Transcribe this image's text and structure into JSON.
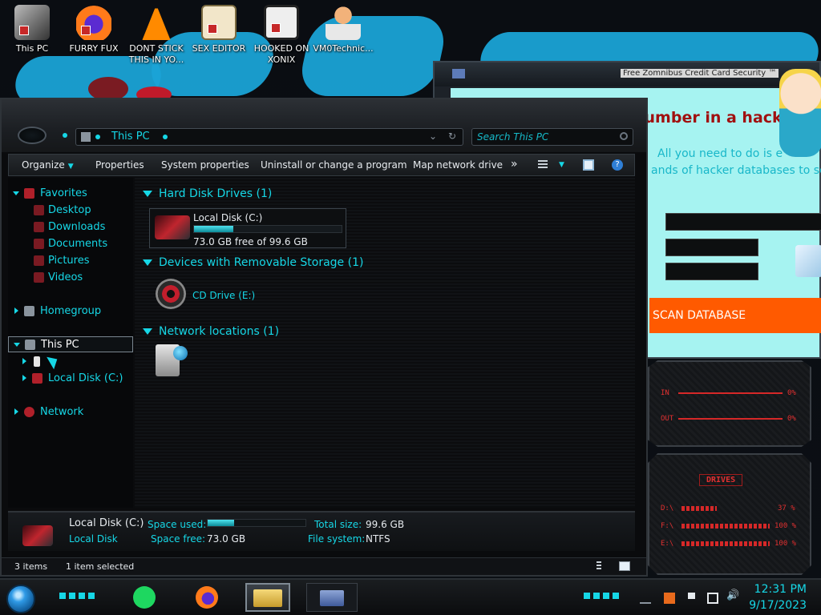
{
  "desktop": {
    "icons": [
      {
        "label": "This PC"
      },
      {
        "label": "FURRY FUX"
      },
      {
        "label": "DONT STICK THIS IN YO..."
      },
      {
        "label": "SEX EDITOR"
      },
      {
        "label": "HOOKED ON XONIX"
      },
      {
        "label": "VM0Technic..."
      }
    ]
  },
  "background_window": {
    "title": "Free Zomnibus Credit Card Security ™",
    "heading": "number in a hack",
    "line1": "All you need to do is e",
    "line2": "ands of hacker databases to see",
    "scan_button": "SCAN DATABASE"
  },
  "widgets": {
    "network_in_label": "IN",
    "network_out_label": "OUT",
    "network_in_value": "0%",
    "network_out_value": "0%",
    "drives_title": "DRIVES",
    "drives": [
      {
        "letter": "D:\\",
        "value": "37 %"
      },
      {
        "letter": "F:\\",
        "value": "100 %"
      },
      {
        "letter": "E:\\",
        "value": "100 %"
      }
    ]
  },
  "explorer": {
    "address": "This PC",
    "search_placeholder": "Search This PC",
    "toolbar": {
      "organize": "Organize",
      "properties": "Properties",
      "system_properties": "System properties",
      "uninstall": "Uninstall or change a program",
      "map_drive": "Map network drive",
      "more": "»"
    },
    "nav": {
      "favorites": "Favorites",
      "desktop": "Desktop",
      "downloads": "Downloads",
      "documents": "Documents",
      "pictures": "Pictures",
      "videos": "Videos",
      "homegroup": "Homegroup",
      "this_pc": "This PC",
      "local_disk": "Local Disk (C:)",
      "network": "Network"
    },
    "groups": {
      "hdd": "Hard Disk Drives (1)",
      "removable": "Devices with Removable Storage (1)",
      "network": "Network locations (1)"
    },
    "drive_c": {
      "name": "Local Disk (C:)",
      "free_text": "73.0 GB free of 99.6 GB",
      "used_fraction": 0.267
    },
    "cd_drive": "CD Drive (E:)",
    "details": {
      "name": "Local Disk (C:)",
      "type": "Local Disk",
      "space_used_label": "Space used:",
      "space_free_label": "Space free:",
      "space_free_value": "73.0 GB",
      "total_size_label": "Total size:",
      "total_size_value": "99.6 GB",
      "file_system_label": "File system:",
      "file_system_value": "NTFS"
    },
    "status": {
      "items": "3 items",
      "selected": "1 item selected"
    }
  },
  "taskbar": {
    "time": "12:31 PM",
    "date": "9/17/2023"
  },
  "colors": {
    "accent": "#16d7e6",
    "scan_button": "#ff5a00",
    "widget_red": "#e23030"
  }
}
